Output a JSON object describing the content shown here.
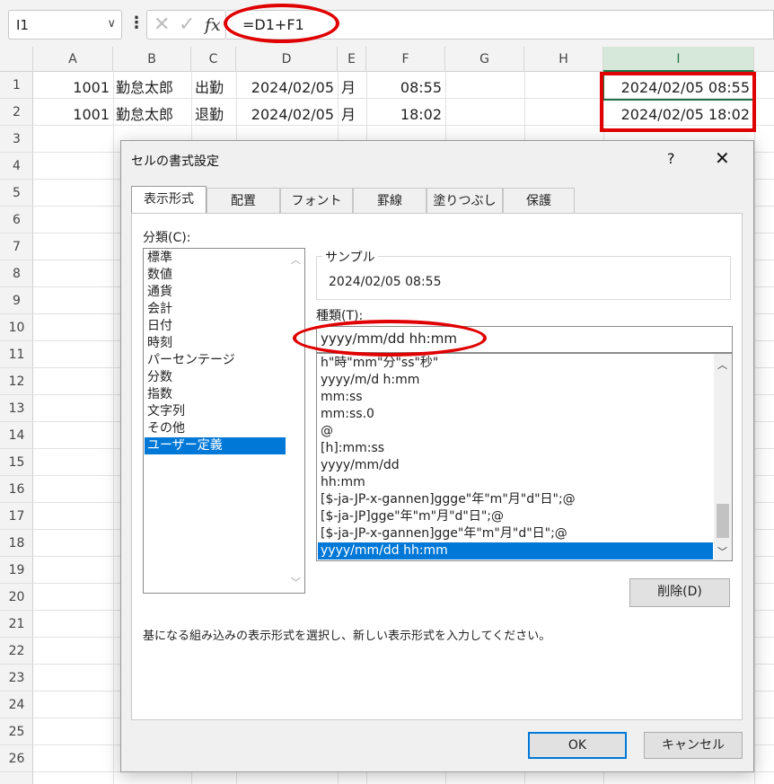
{
  "formula_bar": {
    "name_box": "I1",
    "name_box_chevron": "∨",
    "cancel_glyph": "✕",
    "enter_glyph": "✓",
    "fx_glyph": "fx",
    "formula": "=D1+F1"
  },
  "columns": [
    "A",
    "B",
    "C",
    "D",
    "E",
    "F",
    "G",
    "H",
    "I"
  ],
  "rows": [
    "1",
    "2",
    "3",
    "4",
    "5",
    "6",
    "7",
    "8",
    "9",
    "10",
    "11",
    "12",
    "13",
    "14",
    "15",
    "16",
    "17",
    "18",
    "19",
    "20",
    "21",
    "22",
    "23",
    "24",
    "25",
    "26"
  ],
  "cells": {
    "A1": "1001",
    "B1": "勤怠太郎",
    "C1": "出勤",
    "D1": "2024/02/05",
    "E1": "月",
    "F1": "08:55",
    "I1": "2024/02/05 08:55",
    "A2": "1001",
    "B2": "勤怠太郎",
    "C2": "退勤",
    "D2": "2024/02/05",
    "E2": "月",
    "F2": "18:02",
    "I2": "2024/02/05 18:02"
  },
  "dialog": {
    "title": "セルの書式設定",
    "help": "?",
    "close": "✕",
    "tabs": [
      "表示形式",
      "配置",
      "フォント",
      "罫線",
      "塗りつぶし",
      "保護"
    ],
    "active_tab": 0,
    "category_label": "分類(C):",
    "categories": [
      "標準",
      "数値",
      "通貨",
      "会計",
      "日付",
      "時刻",
      "パーセンテージ",
      "分数",
      "指数",
      "文字列",
      "その他",
      "ユーザー定義"
    ],
    "selected_category": 11,
    "sample_label": "サンプル",
    "sample_value": "2024/02/05 08:55",
    "type_label": "種類(T):",
    "type_value": "yyyy/mm/dd hh:mm",
    "format_list": [
      "h\"時\"mm\"分\"ss\"秒\"",
      "yyyy/m/d h:mm",
      "mm:ss",
      "mm:ss.0",
      "@",
      "[h]:mm:ss",
      "yyyy/mm/dd",
      "hh:mm",
      "[$-ja-JP-x-gannen]ggge\"年\"m\"月\"d\"日\";@",
      "[$-ja-JP]gge\"年\"m\"月\"d\"日\";@",
      "[$-ja-JP-x-gannen]gge\"年\"m\"月\"d\"日\";@",
      "yyyy/mm/dd hh:mm"
    ],
    "selected_format": 11,
    "delete_button": "削除(D)",
    "hint": "基になる組み込みの表示形式を選択し、新しい表示形式を入力してください。",
    "ok_button": "OK",
    "cancel_button": "キャンセル"
  },
  "colors": {
    "selection": "#0078d7",
    "annotation": "#e00000",
    "active_col_header": "#217346"
  }
}
